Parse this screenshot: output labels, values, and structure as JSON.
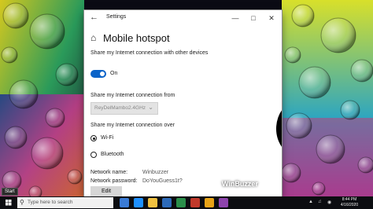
{
  "window": {
    "title": "Settings",
    "page_title": "Mobile hotspot",
    "share_heading": "Share my Internet connection with other devices",
    "toggle_state": "On",
    "from_heading": "Share my Internet connection from",
    "from_value": "ReyDelMambo2.4GHz",
    "over_heading": "Share my Internet connection over",
    "options": [
      "Wi-Fi",
      "Bluetooth"
    ],
    "selected_option": "Wi-Fi",
    "network_name_label": "Network name:",
    "network_name_value": "Winbuzzer",
    "network_password_label": "Network password:",
    "network_password_value": "DoYouGuess1t?",
    "edit_label": "Edit"
  },
  "taskbar": {
    "tooltip": "Start",
    "search_placeholder": "Type here to search",
    "time": "8:44 PM",
    "date": "4/16/2020"
  },
  "watermark": "WinBuzzer",
  "icons": [
    "back-arrow-icon",
    "minimize-icon",
    "maximize-icon",
    "close-icon",
    "home-icon",
    "chevron-down-icon",
    "hotspot-broadcast-icon",
    "windows-logo-icon",
    "search-icon"
  ]
}
